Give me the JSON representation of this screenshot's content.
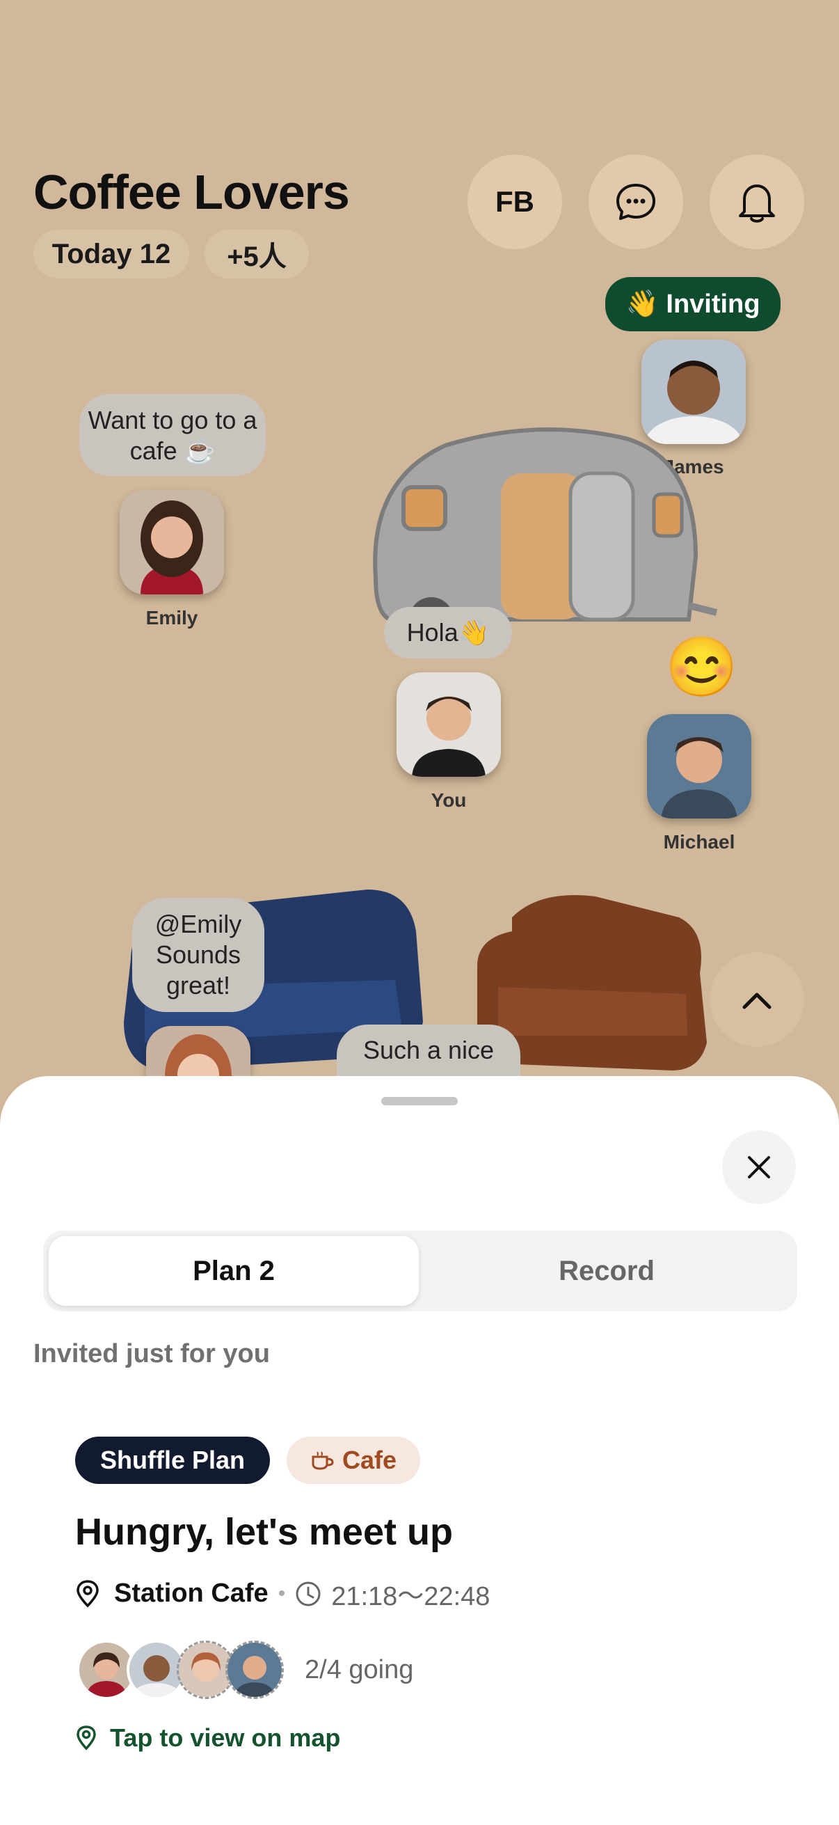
{
  "header": {
    "title": "Coffee Lovers",
    "chip_today": "Today 12",
    "chip_more": "+5人",
    "fb_label": "FB",
    "icons": [
      "chat-bubble-icon",
      "bell-icon"
    ]
  },
  "scene": {
    "inviting_label": "👋 Inviting",
    "people": [
      {
        "name": "James"
      },
      {
        "name": "Emily",
        "bubble": "Want to go to a cafe ☕"
      },
      {
        "name": "You",
        "bubble": "Hola👋"
      },
      {
        "name": "Michael"
      },
      {
        "bubble": "@Emily Sounds great!"
      },
      {
        "bubble": "Such a nice"
      }
    ],
    "emoji": "😊"
  },
  "sheet": {
    "tabs": [
      {
        "label": "Plan 2",
        "active": true
      },
      {
        "label": "Record",
        "active": false
      }
    ],
    "section_title": "Invited just for you",
    "plan": {
      "tag_type": "Shuffle Plan",
      "tag_category": "Cafe",
      "title": "Hungry, let's meet up",
      "location": "Station Cafe",
      "time": "21:18～22:48",
      "going": "2/4 going",
      "map_link": "Tap to view on map"
    }
  },
  "colors": {
    "background": "#d1b89a",
    "invite_green": "#0f4c2f",
    "tag_dark": "#111a2e",
    "cafe_text": "#a04a22",
    "link_green": "#14532d"
  }
}
